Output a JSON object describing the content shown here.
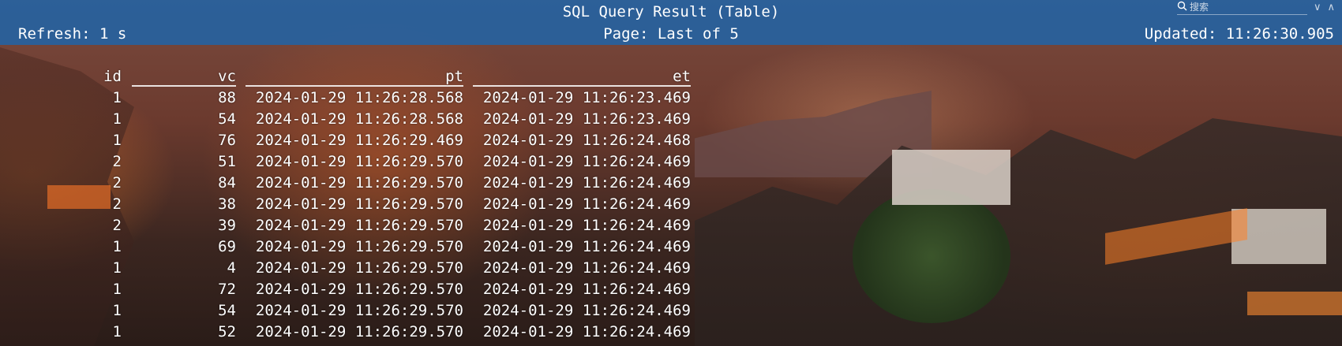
{
  "header": {
    "title": "SQL Query Result (Table)",
    "refresh": "Refresh: 1 s",
    "page": "Page: Last of 5",
    "updated": "Updated: 11:26:30.905"
  },
  "search": {
    "placeholder": "搜索"
  },
  "table": {
    "columns": [
      "id",
      "vc",
      "pt",
      "et"
    ],
    "rows": [
      [
        "1",
        "88",
        "2024-01-29 11:26:28.568",
        "2024-01-29 11:26:23.469"
      ],
      [
        "1",
        "54",
        "2024-01-29 11:26:28.568",
        "2024-01-29 11:26:23.469"
      ],
      [
        "1",
        "76",
        "2024-01-29 11:26:29.469",
        "2024-01-29 11:26:24.468"
      ],
      [
        "2",
        "51",
        "2024-01-29 11:26:29.570",
        "2024-01-29 11:26:24.469"
      ],
      [
        "2",
        "84",
        "2024-01-29 11:26:29.570",
        "2024-01-29 11:26:24.469"
      ],
      [
        "2",
        "38",
        "2024-01-29 11:26:29.570",
        "2024-01-29 11:26:24.469"
      ],
      [
        "2",
        "39",
        "2024-01-29 11:26:29.570",
        "2024-01-29 11:26:24.469"
      ],
      [
        "1",
        "69",
        "2024-01-29 11:26:29.570",
        "2024-01-29 11:26:24.469"
      ],
      [
        "1",
        "4",
        "2024-01-29 11:26:29.570",
        "2024-01-29 11:26:24.469"
      ],
      [
        "1",
        "72",
        "2024-01-29 11:26:29.570",
        "2024-01-29 11:26:24.469"
      ],
      [
        "1",
        "54",
        "2024-01-29 11:26:29.570",
        "2024-01-29 11:26:24.469"
      ],
      [
        "1",
        "52",
        "2024-01-29 11:26:29.570",
        "2024-01-29 11:26:24.469"
      ]
    ]
  },
  "colors": {
    "header_bg": "#2662a0",
    "text": "#ffffff"
  },
  "icons": {
    "search": "search-icon",
    "window_controls": [
      "chevron-down-icon",
      "chevron-up-icon"
    ]
  }
}
